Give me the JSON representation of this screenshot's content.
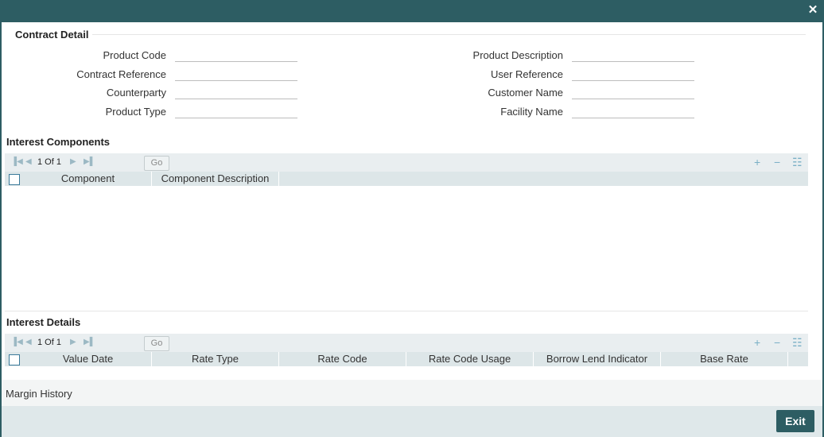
{
  "window": {
    "close_glyph": "✕"
  },
  "contract_detail": {
    "title": "Contract Detail",
    "left_fields": [
      {
        "label": "Product Code",
        "value": ""
      },
      {
        "label": "Contract Reference",
        "value": ""
      },
      {
        "label": "Counterparty",
        "value": ""
      },
      {
        "label": "Product Type",
        "value": ""
      }
    ],
    "right_fields": [
      {
        "label": "Product Description",
        "value": ""
      },
      {
        "label": "User Reference",
        "value": ""
      },
      {
        "label": "Customer Name",
        "value": ""
      },
      {
        "label": "Facility Name",
        "value": ""
      }
    ]
  },
  "interest_components": {
    "title": "Interest Components",
    "pager": "1 Of 1",
    "go_label": "Go",
    "columns": [
      "Component",
      "Component Description"
    ]
  },
  "interest_details": {
    "title": "Interest Details",
    "pager": "1 Of 1",
    "go_label": "Go",
    "columns": [
      "Value Date",
      "Rate Type",
      "Rate Code",
      "Rate Code Usage",
      "Borrow Lend Indicator",
      "Base Rate"
    ]
  },
  "margin_history": {
    "label": "Margin History"
  },
  "footer": {
    "exit_label": "Exit"
  },
  "icons": {
    "first": "first-page-icon",
    "prev": "prev-page-icon",
    "next": "next-page-icon",
    "last": "last-page-icon",
    "add": "add-row-icon",
    "delete": "delete-row-icon",
    "view": "view-columns-icon",
    "close": "close-icon"
  },
  "colors": {
    "titlebar": "#2d5d63",
    "accent": "#7ab0c6",
    "grid_header": "#dde6e8",
    "exit_button": "#2d5d63"
  }
}
